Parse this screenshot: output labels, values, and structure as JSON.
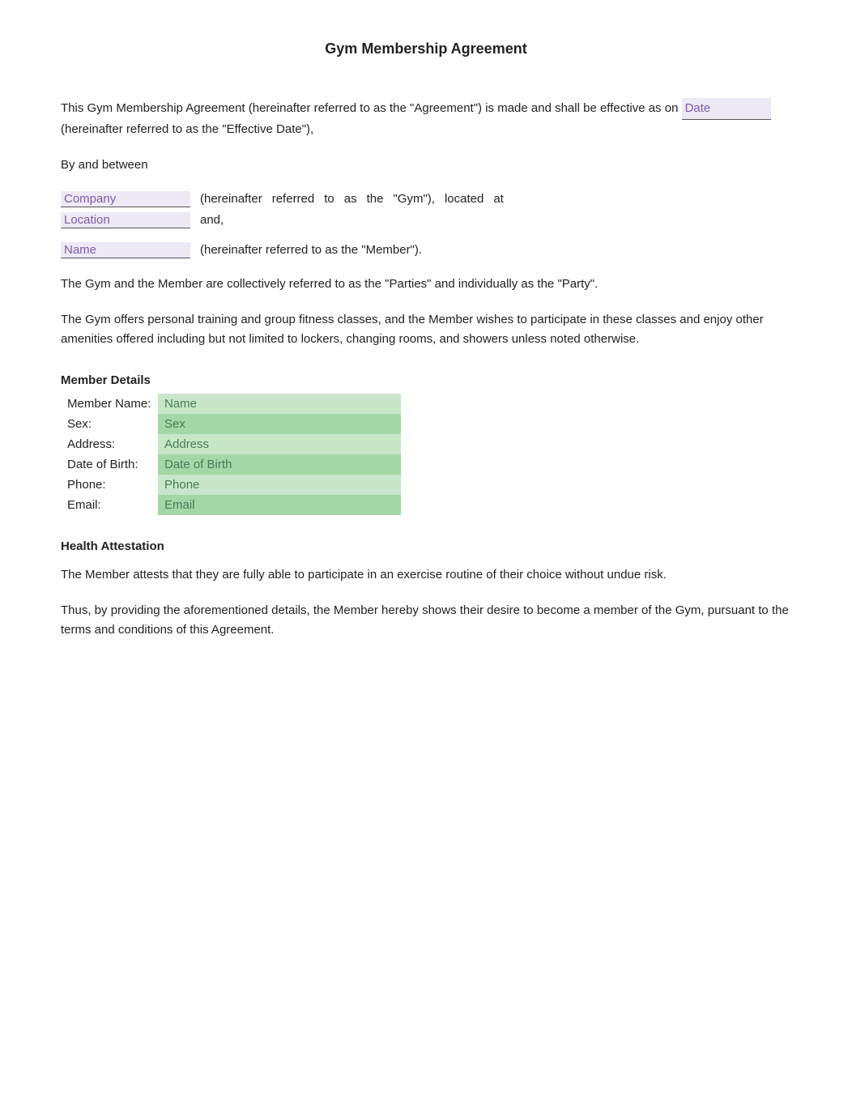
{
  "document": {
    "title": "Gym Membership Agreement",
    "intro": "This Gym Membership Agreement (hereinafter referred to as the \"Agreement\") is made and shall be effective as on",
    "intro_end": "(hereinafter referred to as the \"Effective Date\"),",
    "date_placeholder": "Date",
    "by_and_between": "By and between",
    "company_line": {
      "company_placeholder": "Company",
      "hereinafter": "(hereinafter",
      "referred": "referred",
      "to": "to",
      "as": "as",
      "the": "the",
      "gym_label": "\"Gym\"),",
      "located": "located",
      "at": "at"
    },
    "location_line": {
      "location_placeholder": "Location",
      "and": "and,"
    },
    "name_line": {
      "name_placeholder": "Name",
      "hereinafter_member": "(hereinafter referred to as the \"Member\")."
    },
    "party_paragraph": "The Gym and the Member are collectively referred to as the \"Parties\" and individually as the \"Party\".",
    "gym_paragraph": "The Gym offers personal training and group fitness classes, and the Member wishes to participate in these classes and enjoy other amenities offered including but not limited to lockers, changing rooms, and showers unless noted otherwise.",
    "member_details": {
      "title": "Member Details",
      "fields": [
        {
          "label": "Member Name:",
          "placeholder": "Name"
        },
        {
          "label": "Sex:",
          "placeholder": "Sex"
        },
        {
          "label": "Address:",
          "placeholder": "Address"
        },
        {
          "label": "Date of Birth:",
          "placeholder": "Date of Birth"
        },
        {
          "label": "Phone:",
          "placeholder": "Phone"
        },
        {
          "label": "Email:",
          "placeholder": "Email"
        }
      ]
    },
    "health_attestation": {
      "title": "Health Attestation",
      "paragraph1": "The Member attests that they are fully able to participate in an exercise routine of their choice without undue risk.",
      "paragraph2": "Thus, by providing the aforementioned details, the Member hereby shows their desire to become a member of the Gym, pursuant to the terms and conditions of this Agreement."
    }
  }
}
